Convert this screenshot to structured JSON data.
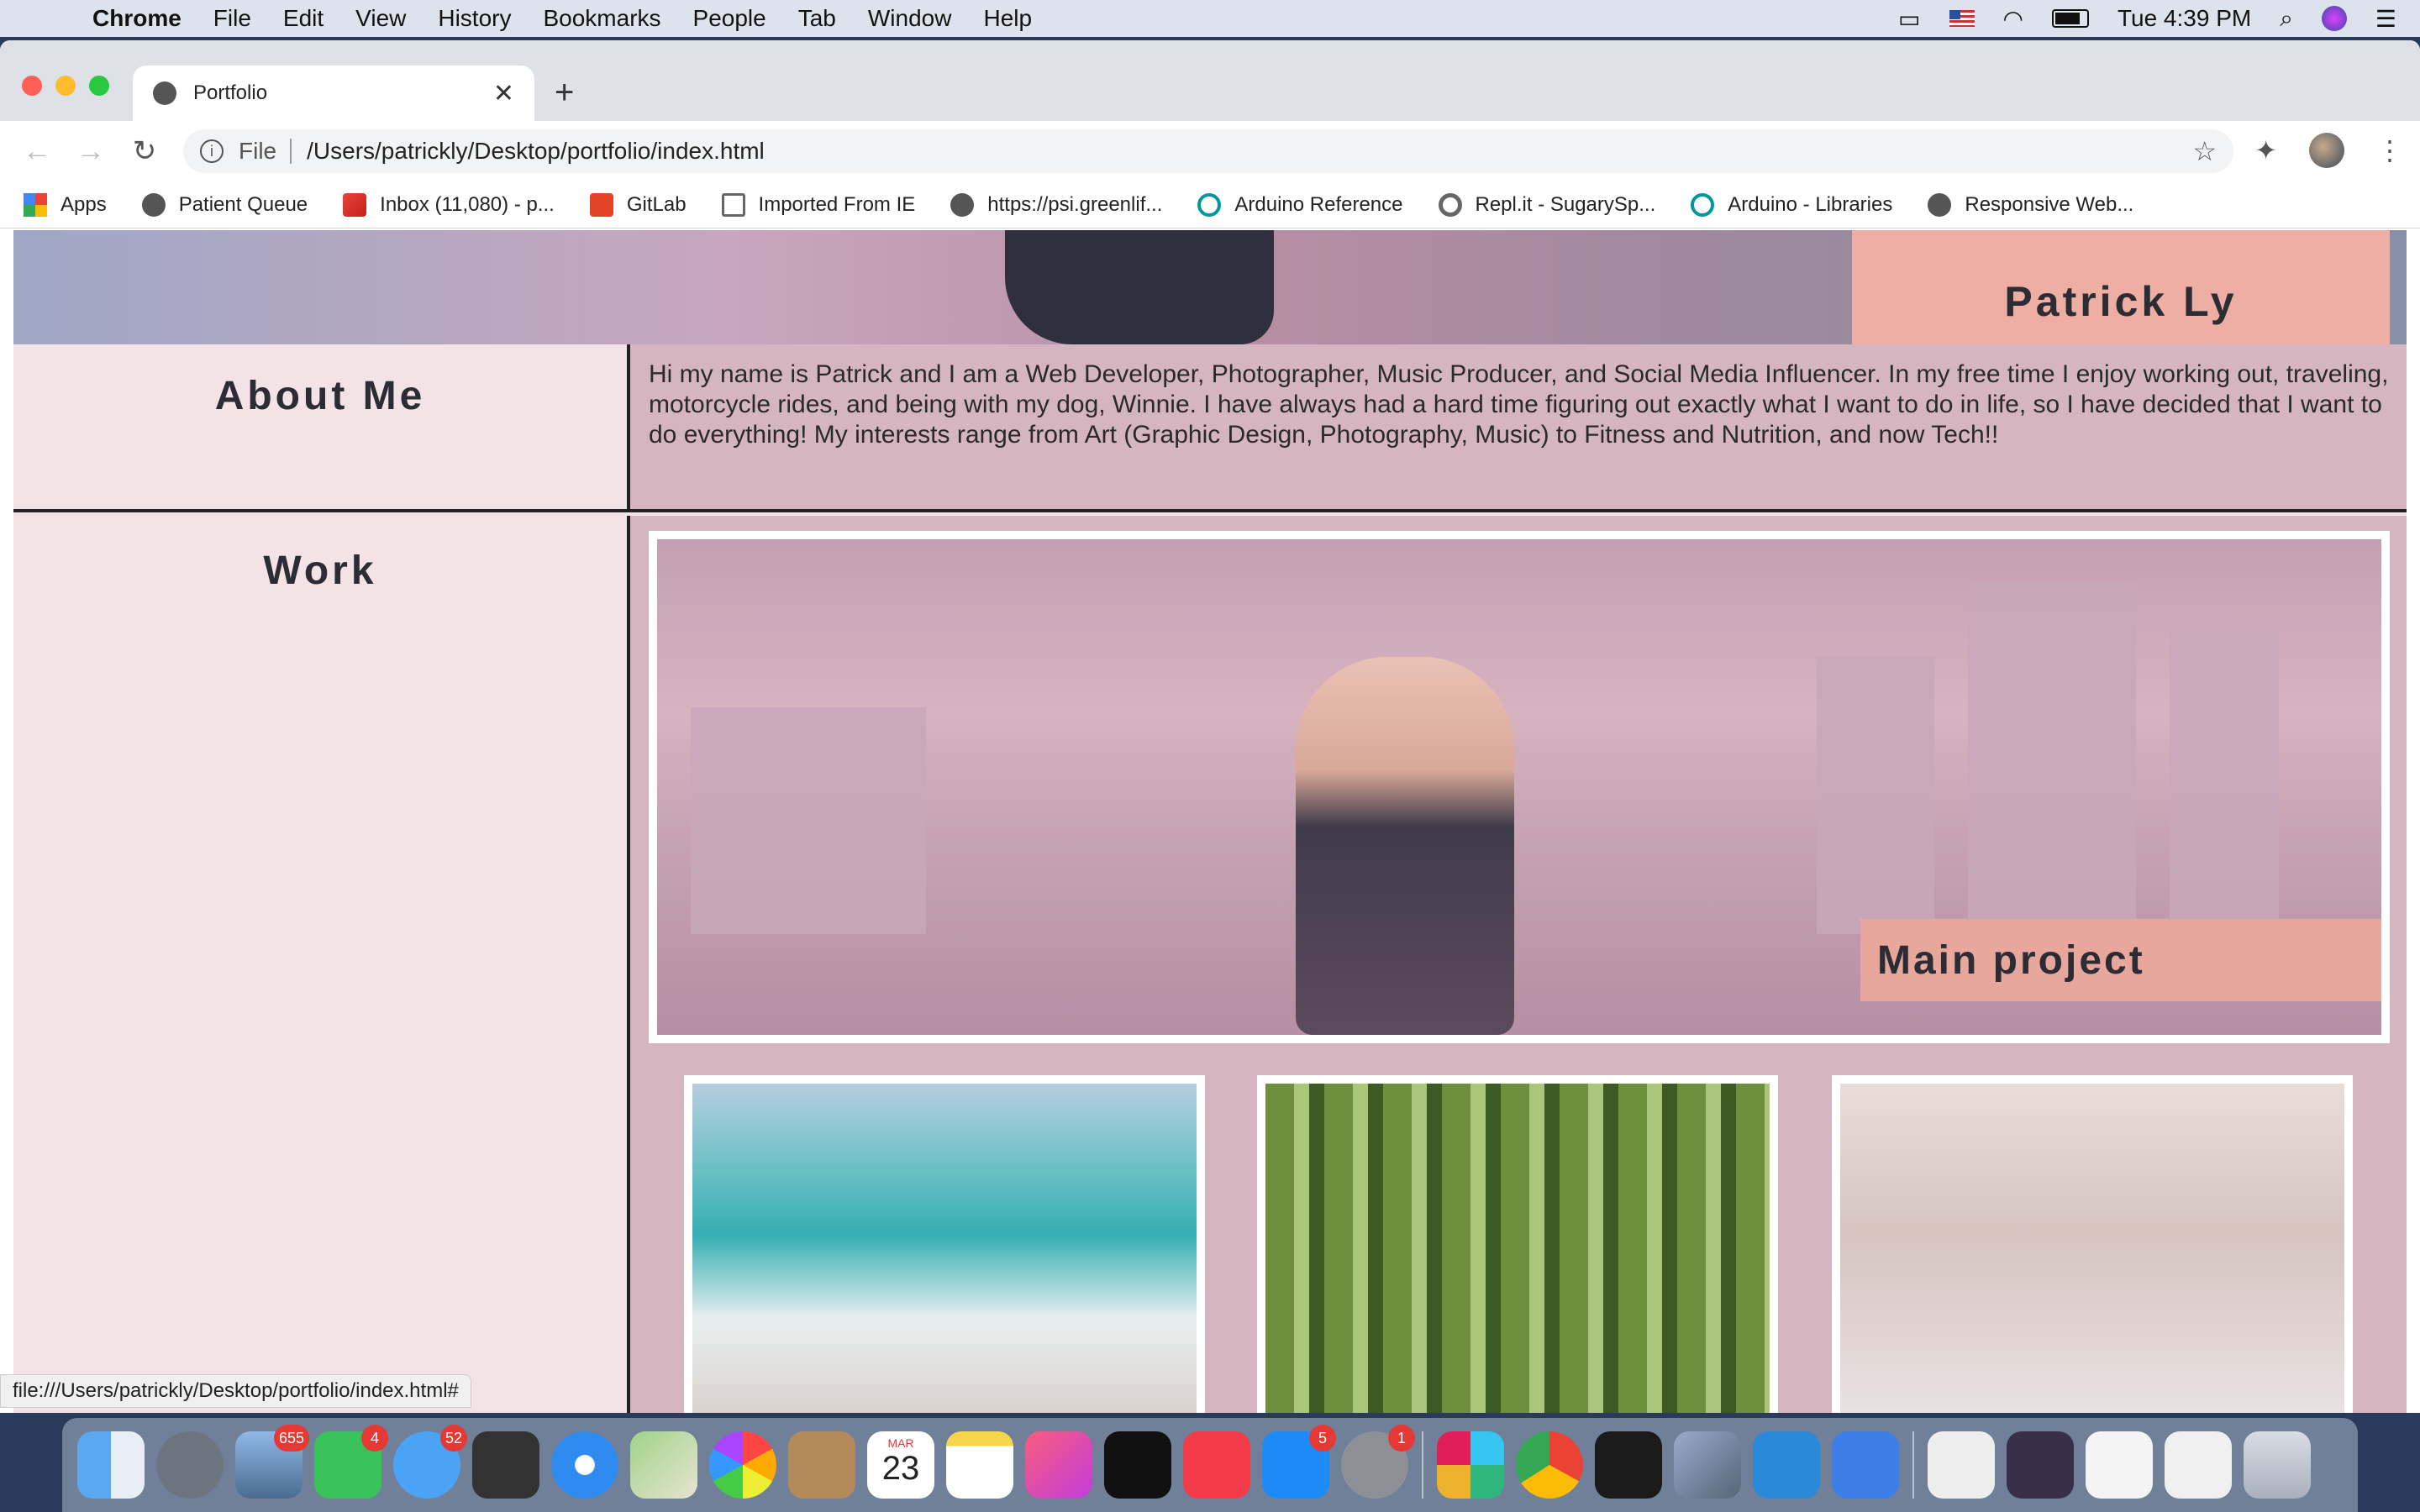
{
  "menubar": {
    "app": "Chrome",
    "items": [
      "File",
      "Edit",
      "View",
      "History",
      "Bookmarks",
      "People",
      "Tab",
      "Window",
      "Help"
    ],
    "clock": "Tue 4:39 PM"
  },
  "browser": {
    "tab_title": "Portfolio",
    "url_scheme": "File",
    "url": "/Users/patrickly/Desktop/portfolio/index.html",
    "status_url": "file:///Users/patrickly/Desktop/portfolio/index.html#"
  },
  "bookmarks": [
    {
      "label": "Apps",
      "icon": "apps-grid-icon"
    },
    {
      "label": "Patient Queue",
      "icon": "globe-icon"
    },
    {
      "label": "Inbox (11,080) - p...",
      "icon": "gmail-icon"
    },
    {
      "label": "GitLab",
      "icon": "gitlab-icon"
    },
    {
      "label": "Imported From IE",
      "icon": "folder-icon"
    },
    {
      "label": "https://psi.greenlif...",
      "icon": "globe-icon"
    },
    {
      "label": "Arduino Reference",
      "icon": "arduino-icon"
    },
    {
      "label": "Repl.it - SugarySp...",
      "icon": "replit-icon"
    },
    {
      "label": "Arduino - Libraries",
      "icon": "arduino-icon"
    },
    {
      "label": "Responsive Web...",
      "icon": "globe-icon"
    }
  ],
  "page": {
    "name": "Patrick Ly",
    "about_heading": "About Me",
    "about_text": "Hi my name is Patrick and I am a Web Developer, Photographer, Music Producer, and Social Media Influencer. In my free time I enjoy working out, traveling, motorcycle rides, and being with my dog, Winnie. I have always had a hard time figuring out exactly what I want to do in life, so I have decided that I want to do everything! My interests range from Art (Graphic Design, Photography, Music) to Fitness and Nutrition, and now Tech!!",
    "work_heading": "Work",
    "main_project_label": "Main project"
  },
  "dock": {
    "badges": {
      "mail": "655",
      "facetime": "4",
      "messages": "52",
      "appstore": "5",
      "settings": "1"
    },
    "calendar_month": "MAR",
    "calendar_day": "23"
  },
  "colors": {
    "page_bg": "#f3e2e6",
    "content_bg": "#d4b5c0",
    "accent_box": "#eeaea3"
  }
}
